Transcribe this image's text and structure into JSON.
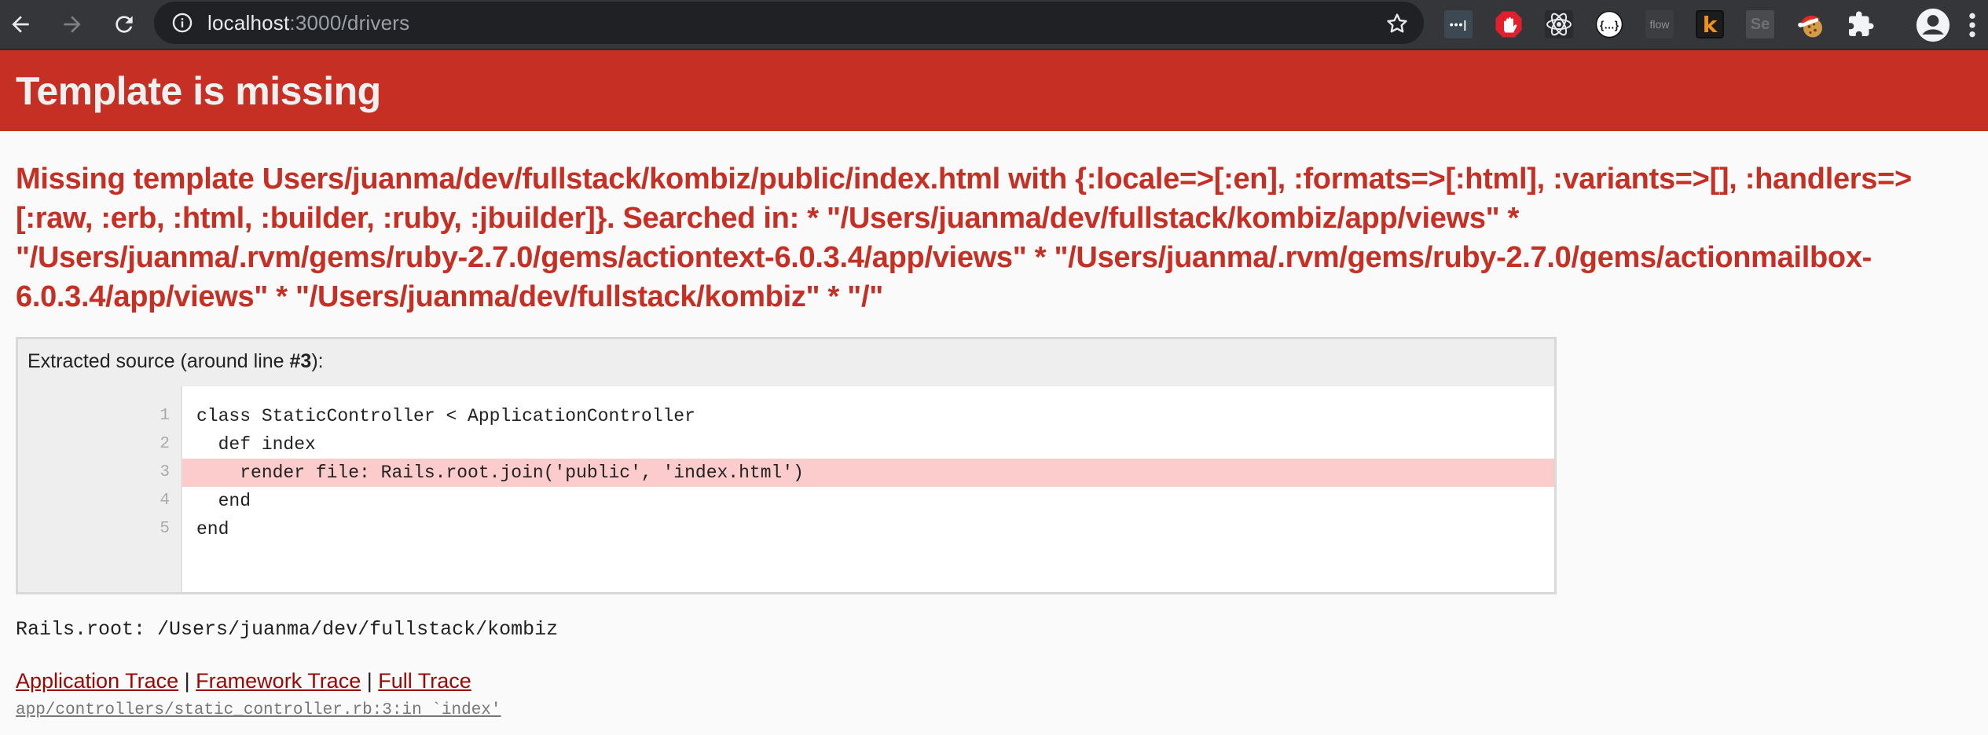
{
  "browser": {
    "url_host": "localhost",
    "url_rest": ":3000/drivers",
    "icons": {
      "back": "arrow-left-icon",
      "forward": "arrow-right-icon",
      "reload": "reload-icon",
      "site_info": "info-icon",
      "bookmark": "star-icon",
      "extensions_menu": "puzzle-icon",
      "profile": "profile-icon",
      "menu": "vertical-dots-icon"
    },
    "extensions": [
      {
        "name": "lastpass",
        "label": "•••|"
      },
      {
        "name": "adblock",
        "label": ""
      },
      {
        "name": "react-devtools",
        "label": ""
      },
      {
        "name": "json-formatter",
        "label": "{…}"
      },
      {
        "name": "flow",
        "label": "flow"
      },
      {
        "name": "k-extension",
        "label": "k"
      },
      {
        "name": "selenium-ide",
        "label": "Se"
      },
      {
        "name": "cookie-editor",
        "label": "🍪"
      }
    ]
  },
  "page": {
    "title": "Template is missing",
    "message": "Missing template Users/juanma/dev/fullstack/kombiz/public/index.html with {:locale=>[:en], :formats=>[:html], :variants=>[], :handlers=>[:raw, :erb, :html, :builder, :ruby, :jbuilder]}. Searched in: * \"/Users/juanma/dev/fullstack/kombiz/app/views\" * \"/Users/juanma/.rvm/gems/ruby-2.7.0/gems/actiontext-6.0.3.4/app/views\" * \"/Users/juanma/.rvm/gems/ruby-2.7.0/gems/actionmailbox-6.0.3.4/app/views\" * \"/Users/juanma/dev/fullstack/kombiz\" * \"/\"",
    "source": {
      "heading_prefix": "Extracted source (around line ",
      "heading_line": "#3",
      "heading_suffix": "):",
      "highlight_line": 3,
      "lines": [
        {
          "num": "1",
          "code": "class StaticController < ApplicationController"
        },
        {
          "num": "2",
          "code": "  def index"
        },
        {
          "num": "3",
          "code": "    render file: Rails.root.join('public', 'index.html')"
        },
        {
          "num": "4",
          "code": "  end"
        },
        {
          "num": "5",
          "code": "end"
        }
      ]
    },
    "rails_root": "Rails.root: /Users/juanma/dev/fullstack/kombiz",
    "traces": {
      "application": "Application Trace",
      "framework": "Framework Trace",
      "full": "Full Trace",
      "separator": "|"
    },
    "trace_line": "app/controllers/static_controller.rb:3:in `index'"
  }
}
